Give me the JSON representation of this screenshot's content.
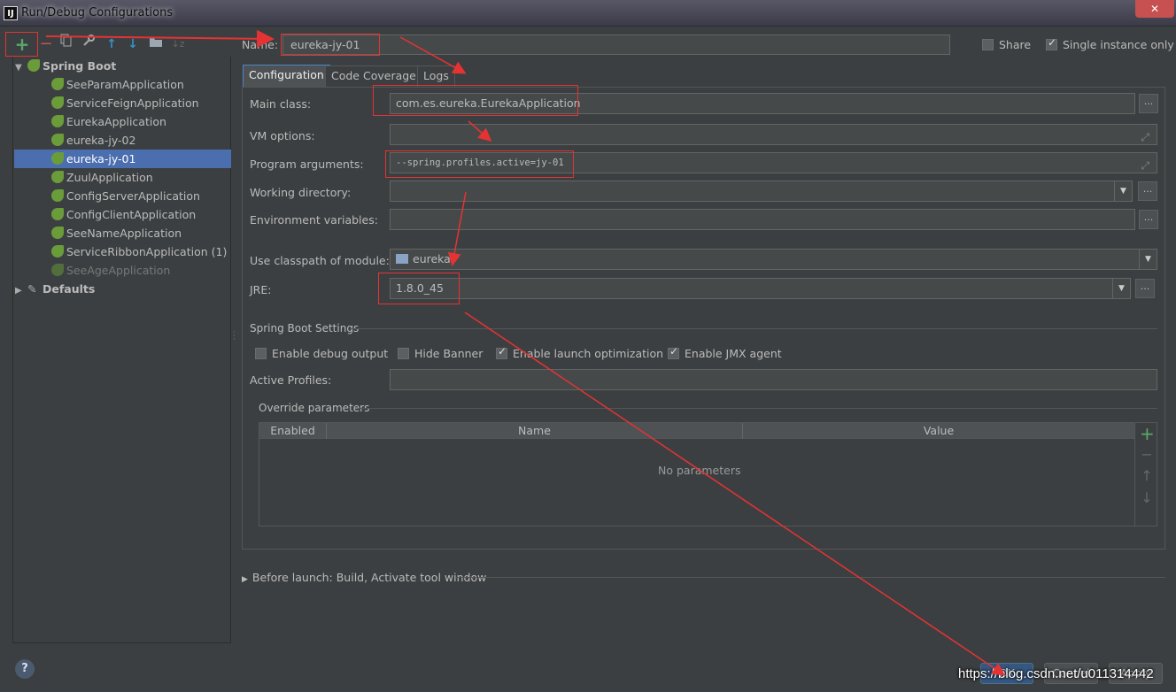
{
  "window": {
    "title": "Run/Debug Configurations",
    "app_icon": "IJ",
    "close_icon": "close-icon"
  },
  "toolbar": {
    "add": "+",
    "remove": "−",
    "copy": "copy-icon",
    "edit_defaults": "wrench-icon",
    "move_up": "↑",
    "move_down": "↓",
    "folder": "folder-icon",
    "sort": "sort-icon"
  },
  "tree": {
    "group_label": "Spring Boot",
    "items": [
      {
        "label": "SeeParamApplication"
      },
      {
        "label": "ServiceFeignApplication"
      },
      {
        "label": "EurekaApplication"
      },
      {
        "label": "eureka-jy-02"
      },
      {
        "label": "eureka-jy-01",
        "selected": true
      },
      {
        "label": "ZuulApplication"
      },
      {
        "label": "ConfigServerApplication"
      },
      {
        "label": "ConfigClientApplication"
      },
      {
        "label": "SeeNameApplication"
      },
      {
        "label": "ServiceRibbonApplication (1)"
      },
      {
        "label": "SeeAgeApplication",
        "disabled": true
      }
    ],
    "defaults_label": "Defaults"
  },
  "header": {
    "name_label": "Name:",
    "name_value": "eureka-jy-01",
    "share_label": "Share",
    "share_checked": false,
    "single_instance_label": "Single instance only",
    "single_instance_checked": true
  },
  "tabs": [
    {
      "label": "Configuration",
      "active": true
    },
    {
      "label": "Code Coverage"
    },
    {
      "label": "Logs"
    }
  ],
  "config": {
    "main_class_label": "Main class:",
    "main_class_value": "com.es.eureka.EurekaApplication",
    "vm_options_label": "VM options:",
    "vm_options_value": "",
    "program_args_label": "Program arguments:",
    "program_args_value": "--spring.profiles.active=jy-01",
    "working_dir_label": "Working directory:",
    "working_dir_value": "",
    "env_vars_label": "Environment variables:",
    "env_vars_value": "",
    "classpath_label": "Use classpath of module:",
    "classpath_value": "eureka",
    "jre_label": "JRE:",
    "jre_value": "1.8.0_45",
    "dots": "..."
  },
  "spring_boot_settings": {
    "title": "Spring Boot Settings",
    "debug_output_label": "Enable debug output",
    "debug_output_checked": false,
    "hide_banner_label": "Hide Banner",
    "hide_banner_checked": false,
    "launch_opt_label": "Enable launch optimization",
    "launch_opt_checked": true,
    "jmx_label": "Enable JMX agent",
    "jmx_checked": true,
    "active_profiles_label": "Active Profiles:",
    "active_profiles_value": ""
  },
  "override": {
    "title": "Override parameters",
    "columns": [
      "Enabled",
      "Name",
      "Value"
    ],
    "empty_text": "No parameters",
    "add": "+",
    "remove": "−",
    "up": "↑",
    "down": "↓"
  },
  "before_launch": {
    "label": "Before launch: Build, Activate tool window"
  },
  "footer": {
    "help": "?",
    "ok": "OK",
    "cancel": "Cancel",
    "apply": "Apply"
  },
  "watermark": "https://blog.csdn.net/u011314442",
  "colors": {
    "accent": "#4b6eaf",
    "annotation": "#e53333",
    "background": "#3c3f41",
    "add_green": "#59a869"
  }
}
